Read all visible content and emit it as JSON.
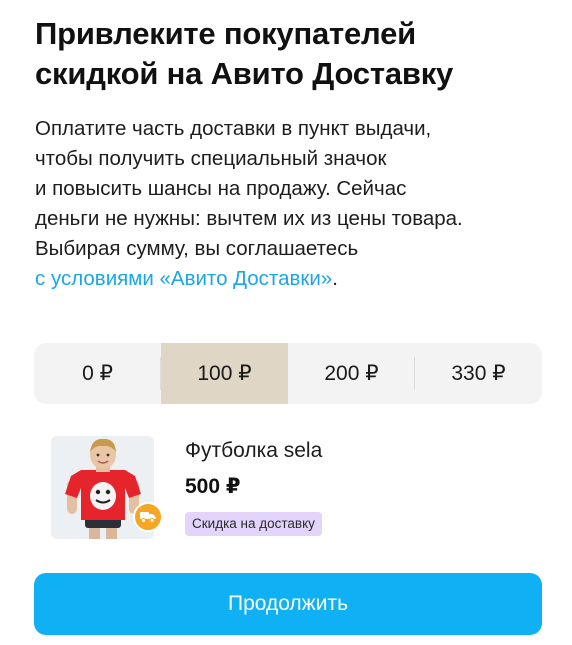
{
  "title_lines": [
    "Привлеките покупателей",
    "скидкой на Авито Доставку"
  ],
  "description": {
    "lines": [
      "Оплатите часть доставки в пункт выдачи,",
      "чтобы получить специальный значок",
      "и повысить шансы на продажу. Сейчас",
      "деньги не нужны: вычтем их из цены товара.",
      "Выбирая сумму, вы соглашаетесь"
    ],
    "link_text": "с условиями «Авито Доставки»",
    "link_suffix": "."
  },
  "amounts": [
    "0 ₽",
    "100 ₽",
    "200 ₽",
    "330 ₽"
  ],
  "selected_amount": "100 ₽",
  "product": {
    "name": "Футболка sela",
    "price": "500 ₽",
    "badge": "Скидка на доставку",
    "image_icon": "tshirt-product-photo",
    "delivery_icon": "truck-icon"
  },
  "continue_label": "Продолжить",
  "colors": {
    "accent": "#10b0f4",
    "link": "#1aa6e8",
    "selected_segment": "#dfd6c5",
    "badge_bg": "#e2d4fb",
    "delivery_badge": "#f5a623"
  }
}
